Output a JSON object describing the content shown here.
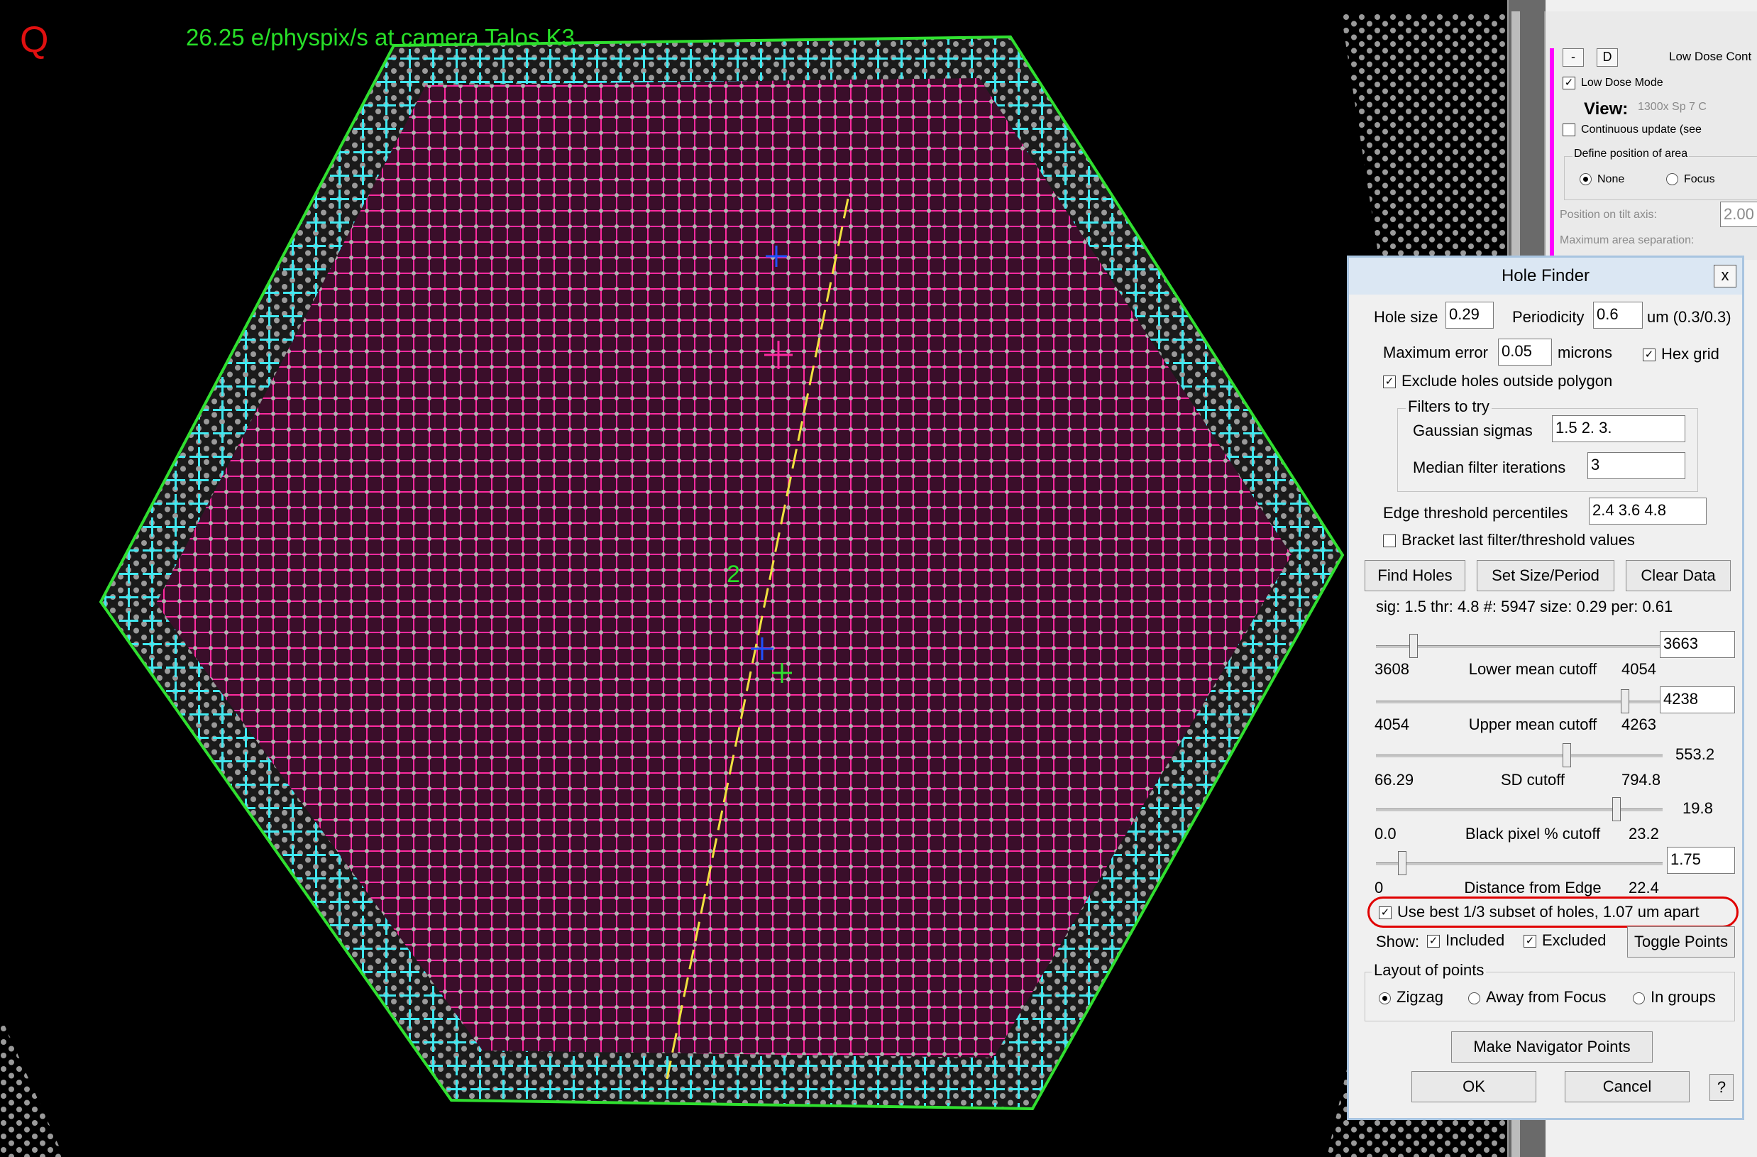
{
  "viewer": {
    "q_mark": "Q",
    "dose_text": "26.25 e/physpix/s at camera     Talos K3",
    "center_label": "2",
    "colors": {
      "included": "#ff2aa0",
      "excluded": "#40e8f0",
      "polygon": "#30e030",
      "line": "#f0e040"
    }
  },
  "low_dose": {
    "minus_btn": "-",
    "d_btn": "D",
    "title": "Low Dose Cont",
    "low_dose_mode_label": "Low Dose Mode",
    "low_dose_mode_checked": true,
    "view_label": "View:",
    "view_values": "1300x   Sp 7   C",
    "continuous_update_label": "Continuous update (see",
    "define_position_label": "Define position of area",
    "none_label": "None",
    "focus_label": "Focus",
    "position_tilt_label": "Position on tilt axis:",
    "position_tilt_value": "2.00",
    "max_sep_label": "Maximum area separation:"
  },
  "hole_finder": {
    "title": "Hole Finder",
    "close": "x",
    "hole_size_label": "Hole size",
    "hole_size_value": "0.29",
    "periodicity_label": "Periodicity",
    "periodicity_value": "0.6",
    "um_label": "um (0.3/0.3)",
    "max_error_label": "Maximum error",
    "max_error_value": "0.05",
    "microns_label": "microns",
    "hex_grid_label": "Hex grid",
    "exclude_outside_label": "Exclude holes outside polygon",
    "filters_group_label": "Filters to try",
    "gaussian_label": "Gaussian sigmas",
    "gaussian_value": "1.5 2. 3.",
    "median_label": "Median filter iterations",
    "median_value": "3",
    "edge_threshold_label": "Edge threshold percentiles",
    "edge_threshold_value": "2.4 3.6 4.8",
    "bracket_label": "Bracket last filter/threshold values",
    "find_holes": "Find Holes",
    "set_size_period": "Set Size/Period",
    "clear_data": "Clear Data",
    "stats_line": "sig: 1.5   thr: 4.8   #: 5947   size: 0.29   per: 0.61",
    "lower_mean": {
      "value": "3663",
      "min": "3608",
      "max": "4054",
      "label": "Lower mean cutoff",
      "level": 0.12
    },
    "upper_mean": {
      "value": "4238",
      "min": "4054",
      "max": "4263",
      "label": "Upper mean cutoff",
      "level": 0.88
    },
    "sd": {
      "value": "553.2",
      "min": "66.29",
      "max": "794.8",
      "label": "SD cutoff",
      "level": 0.67
    },
    "black_pixel": {
      "value": "19.8",
      "min": "0.0",
      "max": "23.2",
      "label": "Black pixel % cutoff",
      "level": 0.85
    },
    "distance_edge": {
      "value": "1.75",
      "min": "0",
      "max": "22.4",
      "label": "Distance from Edge",
      "level": 0.08
    },
    "use_best_label": "Use best 1/3 subset of holes, 1.07 um apart",
    "show_label": "Show:",
    "included_label": "Included",
    "excluded_label": "Excluded",
    "toggle_points": "Toggle Points",
    "layout_group_label": "Layout of points",
    "zigzag_label": "Zigzag",
    "away_focus_label": "Away from Focus",
    "in_groups_label": "In groups",
    "make_nav_points": "Make Navigator Points",
    "ok": "OK",
    "cancel": "Cancel",
    "help": "?"
  }
}
